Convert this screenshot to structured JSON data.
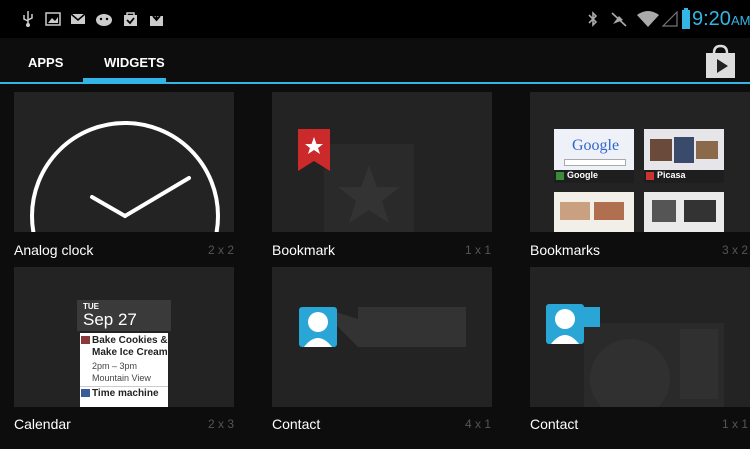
{
  "status_bar": {
    "time": "9:20",
    "ampm": "AM",
    "left_icons": [
      "usb-icon",
      "screenshot-icon",
      "gmail-icon",
      "android-debug-icon",
      "shopping-bag-icon",
      "download-icon"
    ],
    "right_icons": [
      "bluetooth-icon",
      "mute-icon",
      "wifi-icon",
      "signal-icon",
      "battery-icon"
    ]
  },
  "tabs": [
    {
      "label": "APPS"
    },
    {
      "label": "WIDGETS"
    }
  ],
  "widgets": [
    {
      "name": "Analog clock",
      "size": "2 x 2"
    },
    {
      "name": "Bookmark",
      "size": "1 x 1"
    },
    {
      "name": "Bookmarks",
      "size": "3 x 2"
    },
    {
      "name": "Calendar",
      "size": "2 x 3"
    },
    {
      "name": "Contact",
      "size": "4 x 1"
    },
    {
      "name": "Contact",
      "size": "1 x 1"
    }
  ],
  "calendar_preview": {
    "day": "TUE",
    "date": "Sep 27",
    "event1_title_1": "Bake Cookies &",
    "event1_title_2": "Make Ice Cream",
    "event1_time": "2pm – 3pm",
    "event1_place": "Mountain View",
    "event2_title": "Time machine"
  },
  "bookmarks_preview": {
    "thumb1": "Google",
    "thumb2": "Picasa",
    "google_logo": "Google"
  }
}
